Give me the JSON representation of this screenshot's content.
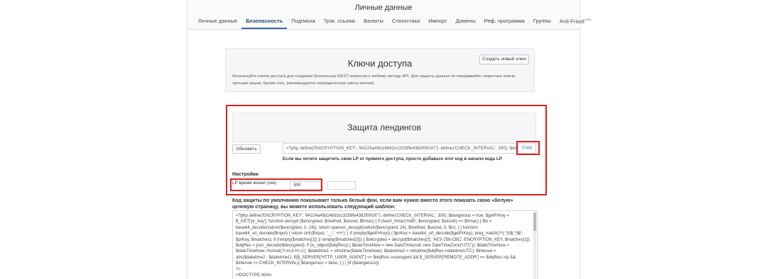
{
  "header": {
    "title": "Личные данные",
    "tabs": [
      {
        "label": "Личные данные",
        "active": false
      },
      {
        "label": "Безопасность",
        "active": true
      },
      {
        "label": "Подписка",
        "active": false
      },
      {
        "label": "Трэк. ссылки",
        "active": false
      },
      {
        "label": "Валюты",
        "active": false
      },
      {
        "label": "Статистика",
        "active": false
      },
      {
        "label": "Импорт",
        "active": false
      },
      {
        "label": "Домены",
        "active": false
      },
      {
        "label": "Реф. программа",
        "active": false
      },
      {
        "label": "Группы",
        "active": false
      },
      {
        "label": "Anti-Fraud",
        "active": false,
        "badge": "new"
      }
    ]
  },
  "access_keys": {
    "title": "Ключи доступа",
    "create_button": "Создать новый ключ",
    "description_line1": "Используйте ключи доступа для создания безопасных REST-запросов к любому методу API. Для защиты данных не передавайте секретные ключи",
    "description_line2": "третьим лицам. Кроме того, рекомендуется периодическая смена ключей."
  },
  "landing_protection": {
    "title": "Защита лендингов",
    "refresh_button": "Обновить",
    "code_value": "<?php define('ENCRYPTION_KEY', '64224a49d14b92cc3259fe4382f00c97'); define('CHECK_INTERVAL', 300); $dangero",
    "copy_button": "Copy",
    "hint": "Если вы хотите защитить свои LP от прямого доступа, просто добавьте этот код в начало кода LP",
    "settings_label": "Настройки",
    "lp_lifetime_label": "LP время жизни (сек)",
    "lp_lifetime_value": "300"
  },
  "template": {
    "note_line1": "Код защиты по умолчанию показывает только белый фон, если вам нужно вместо этого показать свою «белую»",
    "note_line2": "целевую страницу, вы можете использовать следующий шаблон:",
    "code_lines": [
      "<?php define('ENCRYPTION_KEY', '64224a49d14b92cc3259fe4382f00c97'); define('CHECK_INTERVAL', 300); $dangerous = true; $getPrKey =",
      "$_GET['pr_key']; function decrypt ($encrypted, $method, $secret, $hmac) { if (hash_hmac('md5', $encrypted, $secret) == $hmac) { $iv =",
      "base64_decode(substr($encrypted, 0, 24)); return openssl_decrypt(substr($encrypted, 24), $method, $secret, 0, $iv); } } function",
      "base64_url_decode($input) { return strtr($input, '._-', '+/='); } if (empty($getPrKey)) { $prKey = base64_url_decode($getPrKey); preg_match('/^(.*)\\$(.*)$/',",
      "$prKey, $matches); if (!empty($matches[1]) || !empty($matches[2])) { $decrypted = decrypt($matches[2], 'AES-256-CBC', ENCRYPTION_KEY, $matches[1]);",
      "$objRes = json_decode($decrypted); if (is_object($objRes)) { $dateTimeNow = new DateTime(null, new DateTimeZone('UTC')); $dateTimeNow =",
      "$dateTimeNow->format('Y-m-d H:i:s'); $datetime1 = strtotime($dateTimeNow); $datetime2 = strtotime($objRes->datetimeUTC); $interval =",
      "abs($datetime2 - $datetime1); if($_SERVER['HTTP_USER_AGENT'] == $objRes->useragent && $_SERVER['REMOTE_ADDR'] == $objRes->ip &&",
      "$interval <= CHECK_INTERVAL){ $dangerous = false; } } } }if ($dangerous){",
      "?>",
      "<!DOCTYPE html>"
    ]
  }
}
